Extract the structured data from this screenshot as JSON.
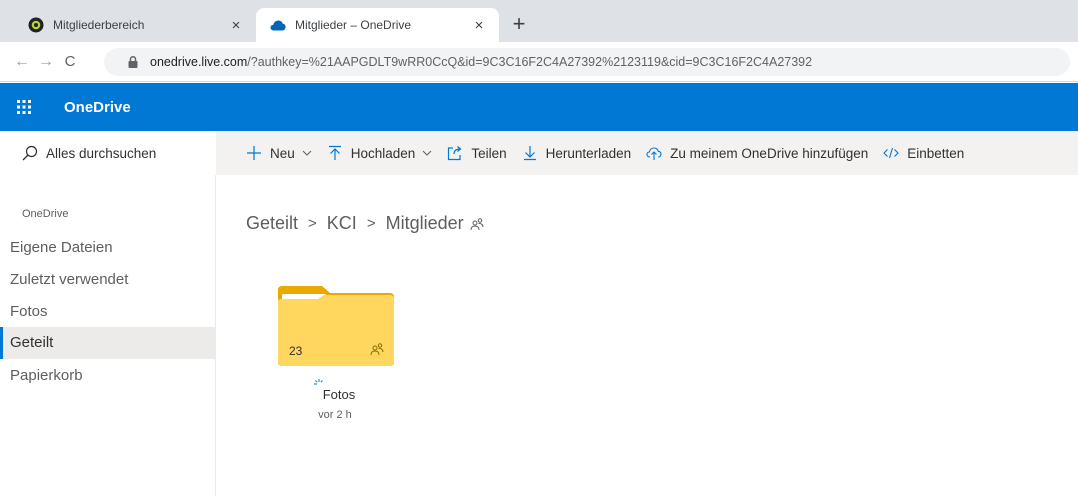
{
  "browser": {
    "tabs": [
      {
        "title": "Mitgliederbereich",
        "close": "×",
        "icon": "circle-logo-icon"
      },
      {
        "title": "Mitglieder – OneDrive",
        "close": "×",
        "icon": "onedrive-cloud-icon"
      }
    ],
    "new_tab": "+",
    "url_host": "onedrive.live.com",
    "url_rest": "/?authkey=%21AAPGDLT9wRR0CcQ&id=9C3C16F2C4A27392%2123119&cid=9C3C16F2C4A27392"
  },
  "appbar": {
    "title": "OneDrive",
    "color": "#0078d4"
  },
  "search": {
    "label": "Alles durchsuchen"
  },
  "commands": {
    "new": "Neu",
    "upload": "Hochladen",
    "share": "Teilen",
    "download": "Herunterladen",
    "add_to_onedrive": "Zu meinem OneDrive hinzufügen",
    "embed": "Einbetten"
  },
  "nav": {
    "group": "OneDrive",
    "items": [
      {
        "label": "Eigene Dateien"
      },
      {
        "label": "Zuletzt verwendet"
      },
      {
        "label": "Fotos"
      },
      {
        "label": "Geteilt"
      },
      {
        "label": "Papierkorb"
      }
    ],
    "selected": "Geteilt"
  },
  "breadcrumb": {
    "items": [
      "Geteilt",
      "KCI",
      "Mitglieder"
    ],
    "separator": ">"
  },
  "folder": {
    "name": "Fotos",
    "count": "23",
    "modified": "vor 2 h",
    "color": "#ffd75e"
  }
}
